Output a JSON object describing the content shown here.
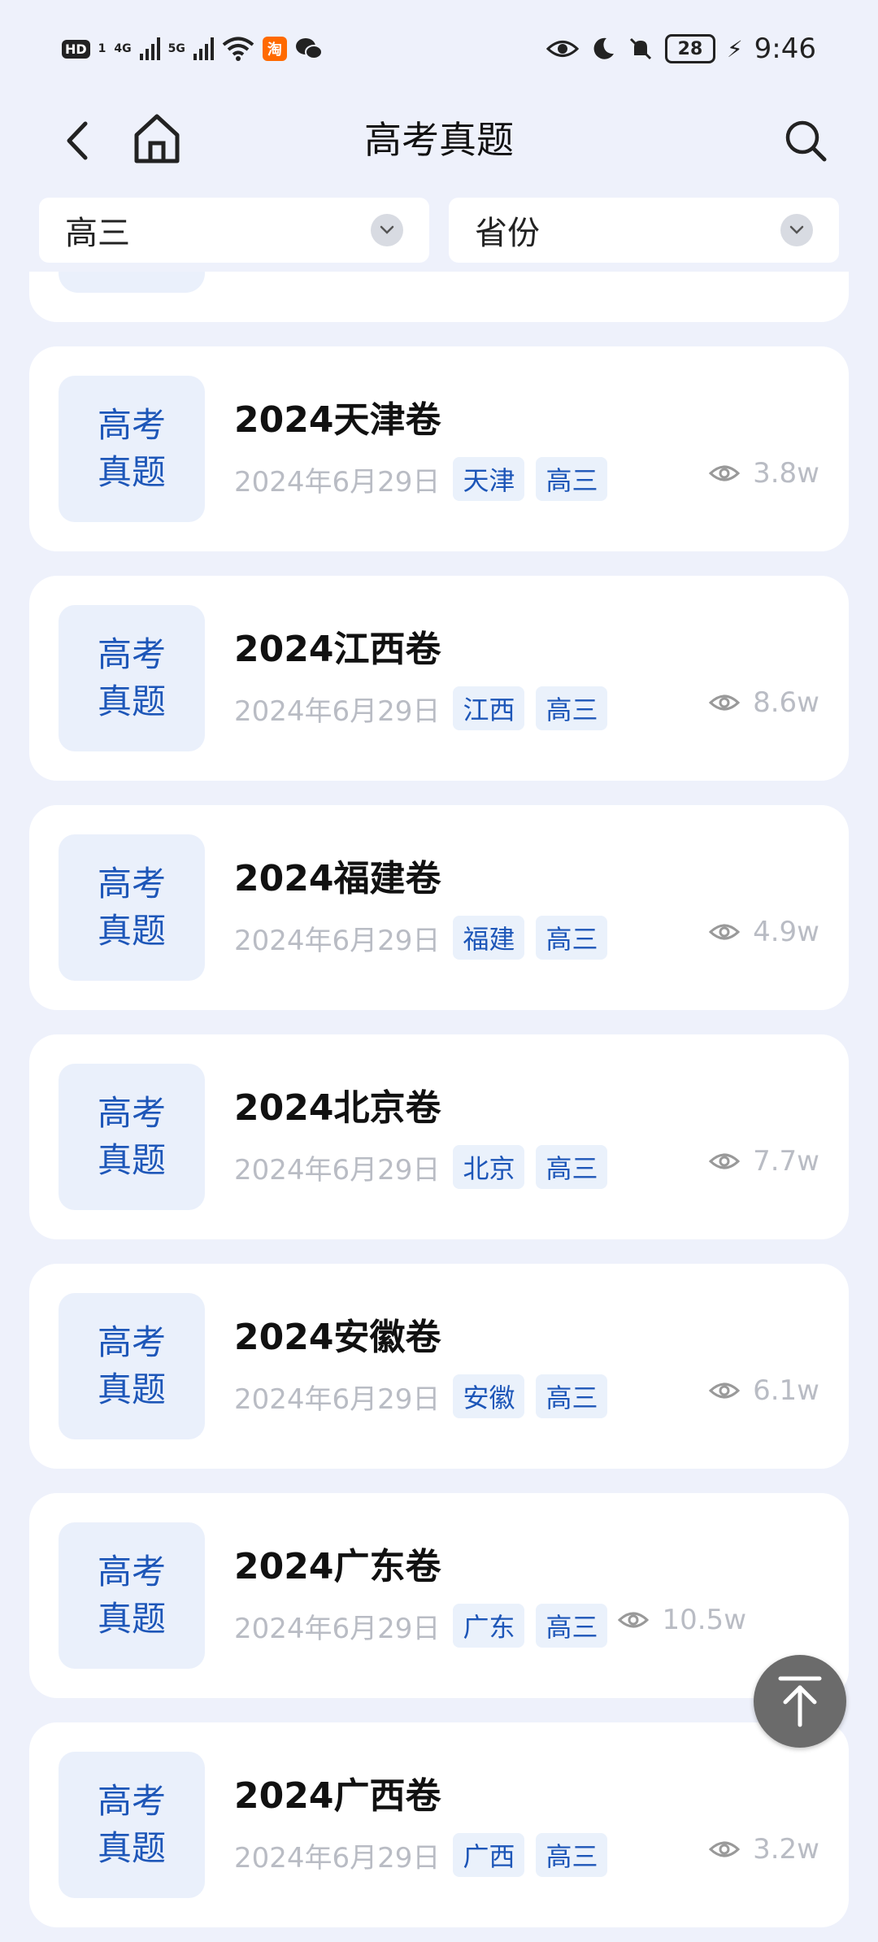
{
  "status_bar": {
    "hd": "HD",
    "hd_sub": "1",
    "net1": "4G",
    "net2": "5G",
    "app_icon_taobao": "淘",
    "battery": "28",
    "time": "9:46"
  },
  "header": {
    "title": "高考真题"
  },
  "filters": {
    "grade": "高三",
    "province": "省份"
  },
  "thumb_text": {
    "line1": "高考",
    "line2": "真题"
  },
  "items": [
    {
      "title": "2024天津卷",
      "date": "2024年6月29日",
      "tag_region": "天津",
      "tag_grade": "高三",
      "views": "3.8w"
    },
    {
      "title": "2024江西卷",
      "date": "2024年6月29日",
      "tag_region": "江西",
      "tag_grade": "高三",
      "views": "8.6w"
    },
    {
      "title": "2024福建卷",
      "date": "2024年6月29日",
      "tag_region": "福建",
      "tag_grade": "高三",
      "views": "4.9w"
    },
    {
      "title": "2024北京卷",
      "date": "2024年6月29日",
      "tag_region": "北京",
      "tag_grade": "高三",
      "views": "7.7w"
    },
    {
      "title": "2024安徽卷",
      "date": "2024年6月29日",
      "tag_region": "安徽",
      "tag_grade": "高三",
      "views": "6.1w"
    },
    {
      "title": "2024广东卷",
      "date": "2024年6月29日",
      "tag_region": "广东",
      "tag_grade": "高三",
      "views": "10.5w"
    },
    {
      "title": "2024广西卷",
      "date": "2024年6月29日",
      "tag_region": "广西",
      "tag_grade": "高三",
      "views": "3.2w"
    }
  ],
  "colors": {
    "accent": "#1d56b8",
    "background": "#eef1fb",
    "muted": "#b9bcc4"
  }
}
